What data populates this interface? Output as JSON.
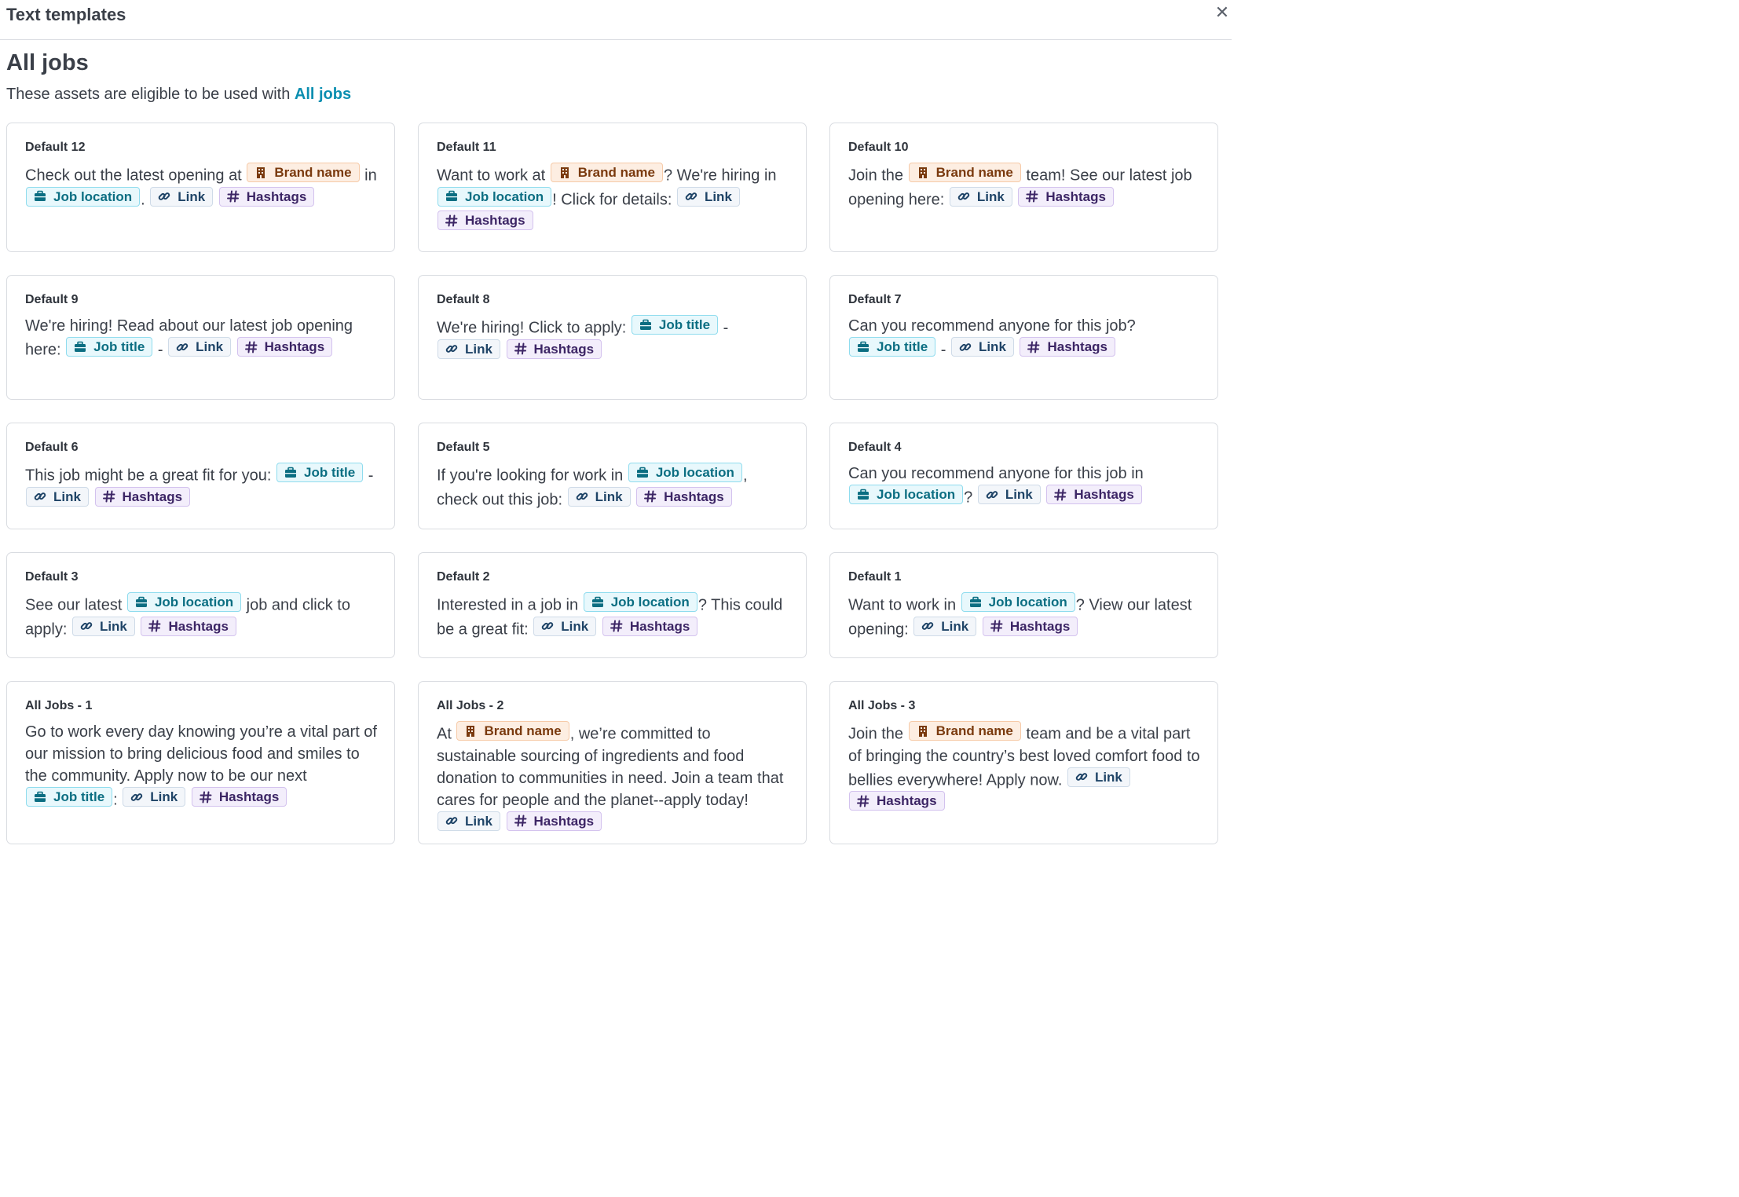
{
  "header": {
    "title": "Text templates",
    "close_label": "✕"
  },
  "main": {
    "title": "All jobs",
    "subtitle_text": "These assets are eligible to be used with ",
    "subtitle_link": "All jobs"
  },
  "chips": {
    "brand": "Brand name",
    "location": "Job location",
    "link": "Link",
    "hashtags": "Hashtags",
    "job_title": "Job title"
  },
  "icons": {
    "brand": "building-icon",
    "location": "briefcase-icon",
    "job_title": "briefcase-icon",
    "link": "link-icon",
    "hashtags": "hashtag-icon"
  },
  "colors": {
    "accent": "#0a8eb0",
    "brand_chip": "#fdeee2",
    "location_chip": "#e8f8fc",
    "link_chip": "#f3f6fa",
    "hashtag_chip": "#f3eefb"
  },
  "templates": [
    {
      "title": "Default 12",
      "parts": [
        {
          "t": "Check out the latest opening at "
        },
        {
          "c": "brand"
        },
        {
          "t": " in "
        },
        {
          "c": "location"
        },
        {
          "t": ". "
        },
        {
          "c": "link"
        },
        {
          "t": " "
        },
        {
          "c": "hashtags"
        }
      ]
    },
    {
      "title": "Default 11",
      "parts": [
        {
          "t": "Want to work at "
        },
        {
          "c": "brand"
        },
        {
          "t": "? We're hiring in "
        },
        {
          "c": "location"
        },
        {
          "t": "! Click for details: "
        },
        {
          "c": "link"
        },
        {
          "t": " "
        },
        {
          "c": "hashtags"
        }
      ]
    },
    {
      "title": "Default 10",
      "parts": [
        {
          "t": "Join the "
        },
        {
          "c": "brand"
        },
        {
          "t": " team! See our latest job opening here: "
        },
        {
          "c": "link"
        },
        {
          "t": " "
        },
        {
          "c": "hashtags"
        }
      ]
    },
    {
      "title": "Default 9",
      "parts": [
        {
          "t": "We're hiring! Read about our latest job opening here: "
        },
        {
          "c": "job_title"
        },
        {
          "t": " - "
        },
        {
          "c": "link"
        },
        {
          "t": " "
        },
        {
          "c": "hashtags"
        }
      ]
    },
    {
      "title": "Default 8",
      "parts": [
        {
          "t": "We're hiring! Click to apply: "
        },
        {
          "c": "job_title"
        },
        {
          "t": " - "
        },
        {
          "c": "link"
        },
        {
          "t": " "
        },
        {
          "c": "hashtags"
        }
      ]
    },
    {
      "title": "Default 7",
      "parts": [
        {
          "t": "Can you recommend anyone for this job? "
        },
        {
          "c": "job_title"
        },
        {
          "t": " - "
        },
        {
          "c": "link"
        },
        {
          "t": " "
        },
        {
          "c": "hashtags"
        }
      ]
    },
    {
      "title": "Default 6",
      "parts": [
        {
          "t": "This job might be a great fit for you: "
        },
        {
          "c": "job_title"
        },
        {
          "t": " - "
        },
        {
          "c": "link"
        },
        {
          "t": " "
        },
        {
          "c": "hashtags"
        }
      ]
    },
    {
      "title": "Default 5",
      "parts": [
        {
          "t": "If you're looking for work in "
        },
        {
          "c": "location"
        },
        {
          "t": ", check out this job: "
        },
        {
          "c": "link"
        },
        {
          "t": " "
        },
        {
          "c": "hashtags"
        }
      ]
    },
    {
      "title": "Default 4",
      "parts": [
        {
          "t": "Can you recommend anyone for this job in "
        },
        {
          "c": "location"
        },
        {
          "t": "? "
        },
        {
          "c": "link"
        },
        {
          "t": " "
        },
        {
          "c": "hashtags"
        }
      ]
    },
    {
      "title": "Default 3",
      "parts": [
        {
          "t": "See our latest "
        },
        {
          "c": "location"
        },
        {
          "t": " job and click to apply: "
        },
        {
          "c": "link"
        },
        {
          "t": " "
        },
        {
          "c": "hashtags"
        }
      ]
    },
    {
      "title": "Default 2",
      "parts": [
        {
          "t": "Interested in a job in "
        },
        {
          "c": "location"
        },
        {
          "t": "? This could be a great fit: "
        },
        {
          "c": "link"
        },
        {
          "t": " "
        },
        {
          "c": "hashtags"
        }
      ]
    },
    {
      "title": "Default 1",
      "parts": [
        {
          "t": "Want to work in "
        },
        {
          "c": "location"
        },
        {
          "t": "? View our latest opening: "
        },
        {
          "c": "link"
        },
        {
          "t": " "
        },
        {
          "c": "hashtags"
        }
      ]
    },
    {
      "title": "All Jobs - 1",
      "parts": [
        {
          "t": "Go to work every day knowing you’re a vital part of our mission to bring delicious food and smiles to the community. Apply now to be our next "
        },
        {
          "c": "job_title"
        },
        {
          "t": ": "
        },
        {
          "c": "link"
        },
        {
          "t": " "
        },
        {
          "c": "hashtags"
        }
      ]
    },
    {
      "title": "All Jobs - 2",
      "parts": [
        {
          "t": "At "
        },
        {
          "c": "brand"
        },
        {
          "t": ", we’re committed to sustainable sourcing of ingredients and food donation to communities in need. Join a team that cares for people and the planet--apply today! "
        },
        {
          "c": "link"
        },
        {
          "t": " "
        },
        {
          "c": "hashtags"
        }
      ]
    },
    {
      "title": "All Jobs - 3",
      "parts": [
        {
          "t": "Join the "
        },
        {
          "c": "brand"
        },
        {
          "t": " team and be a vital part of bringing the country’s best loved comfort food to bellies everywhere! Apply now. "
        },
        {
          "c": "link"
        },
        {
          "t": " "
        },
        {
          "c": "hashtags"
        }
      ]
    }
  ]
}
